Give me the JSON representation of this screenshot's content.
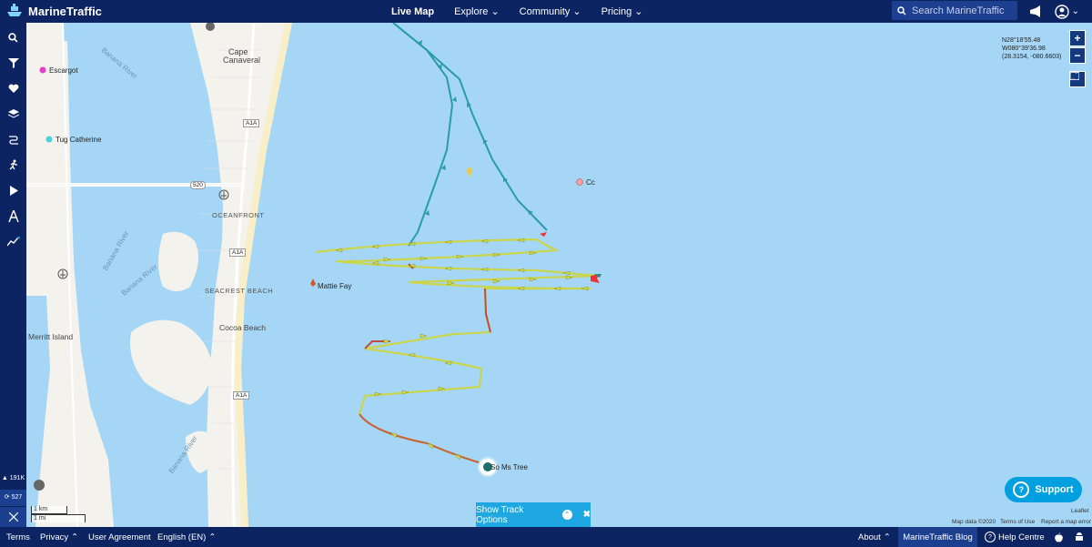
{
  "header": {
    "brand": "MarineTraffic",
    "nav": [
      {
        "label": "Live Map"
      },
      {
        "label": "Explore"
      },
      {
        "label": "Community"
      },
      {
        "label": "Pricing"
      }
    ],
    "search_placeholder": "Search MarineTraffic"
  },
  "sidebar": {
    "icons": [
      "search-icon",
      "filter-icon",
      "heart-icon",
      "layers-icon",
      "route-icon",
      "running-icon",
      "play-icon",
      "compass-icon",
      "chart-icon"
    ],
    "vessel_count": "191K",
    "other_count": "527"
  },
  "map": {
    "coordinates": {
      "lat": "N28°18'55.48",
      "lon": "W080°39'36.98",
      "decimal": "(28.3154, -080.6603)"
    },
    "zoom_in": "+",
    "zoom_out": "−",
    "place_labels": {
      "cape": "Cape",
      "canaveral": "Canaveral",
      "oceanfront": "OCEANFRONT",
      "seacrest": "SEACREST BEACH",
      "cocoa": "Cocoa Beach",
      "merritt": "Merritt Island",
      "banana1": "Banana River",
      "banana2": "Banana River",
      "banana3": "Banana River",
      "banana4": "Banana River",
      "route520": "520",
      "a1a_1": "A1A",
      "a1a_2": "A1A",
      "a1a_3": "A1A"
    },
    "vessels": {
      "escargot": "Escargot",
      "tug": "Tug Catherine",
      "mattie": "Mattie Fay",
      "cc": "Cc",
      "tree": "So Ms Tree"
    },
    "scale_km": "1 km",
    "scale_mi": "1 mi",
    "leaflet": "Leaflet",
    "attribution": [
      "Map data ©2020",
      "Terms of Use",
      "Report a map error"
    ],
    "support": "Support",
    "track_options": "Show Track Options"
  },
  "footer": {
    "terms": "Terms",
    "privacy": "Privacy",
    "agreement": "User Agreement",
    "language": "English (EN)",
    "about": "About",
    "blog": "MarineTraffic Blog",
    "help": "Help Centre"
  },
  "colors": {
    "navy": "#0c2461",
    "sea": "#a6d6f5",
    "land": "#f2f2ee",
    "accent": "#00a0e0"
  }
}
